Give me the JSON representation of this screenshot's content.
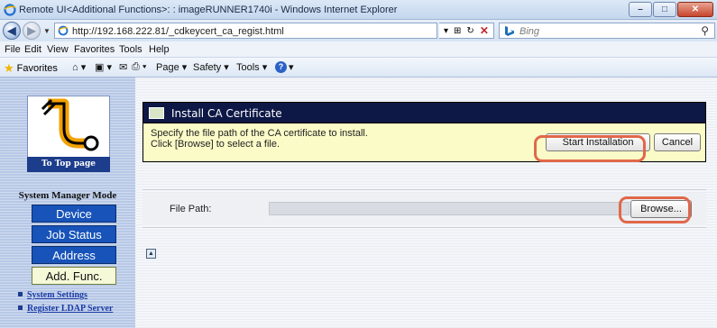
{
  "window": {
    "title": "Remote UI<Additional Functions>: : imageRUNNER1740i - Windows Internet Explorer",
    "minimize": "–",
    "maximize": "□",
    "close": "✕"
  },
  "address_bar": {
    "url": "http://192.168.222.81/_cdkeycert_ca_regist.html",
    "search_placeholder": "Bing"
  },
  "menu": [
    "File",
    "Edit",
    "View",
    "Favorites",
    "Tools",
    "Help"
  ],
  "command_bar": {
    "favorites": "Favorites",
    "page": "Page ▾",
    "safety": "Safety ▾",
    "tools": "Tools ▾"
  },
  "sidebar": {
    "to_top": "To Top page",
    "mode_title": "System Manager Mode",
    "buttons": [
      "Device",
      "Job Status",
      "Address",
      "Add. Func."
    ],
    "selected_button": "Add. Func.",
    "links": [
      "System Settings",
      "Register LDAP Server"
    ]
  },
  "main": {
    "header_title": "Install CA Certificate",
    "info_line1": "Specify the file path of the CA certificate to install.",
    "info_line2": "Click [Browse] to select a file.",
    "start_button": "Start Installation",
    "cancel_button": "Cancel",
    "file_path_label": "File Path:",
    "browse_button": "Browse...",
    "file_path_value": ""
  },
  "colors": {
    "header_bg": "#0d1846",
    "info_bg": "#fbfbc8",
    "mode_button_bg": "#1753b9",
    "highlight": "#e0684a"
  }
}
